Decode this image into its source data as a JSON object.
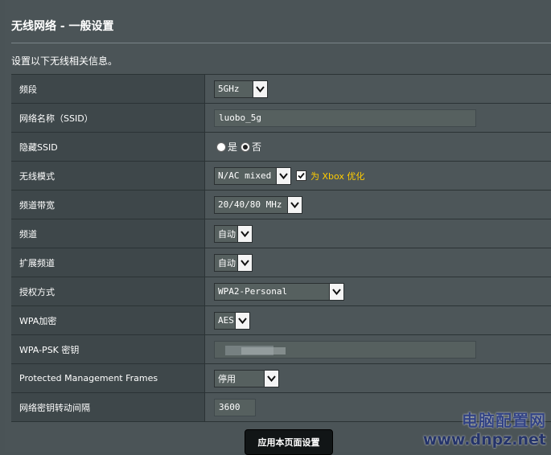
{
  "page": {
    "title": "无线网络 - 一般设置",
    "description": "设置以下无线相关信息。"
  },
  "rows": {
    "band": {
      "label": "频段",
      "value": "5GHz"
    },
    "ssid": {
      "label": "网络名称（SSID）",
      "value": "luobo_5g"
    },
    "hide_ssid": {
      "label": "隐藏SSID",
      "opt_yes": "是",
      "opt_no": "否",
      "selected": "否"
    },
    "wireless_mode": {
      "label": "无线模式",
      "value": "N/AC mixed",
      "xbox_label": "为 Xbox 优化",
      "xbox_checked": true
    },
    "bandwidth": {
      "label": "频道带宽",
      "value": "20/40/80 MHz"
    },
    "channel": {
      "label": "频道",
      "value": "自动"
    },
    "ext_channel": {
      "label": "扩展频道",
      "value": "自动"
    },
    "auth": {
      "label": "授权方式",
      "value": "WPA2-Personal"
    },
    "wpa_enc": {
      "label": "WPA加密",
      "value": "AES"
    },
    "psk": {
      "label": "WPA-PSK 密钥",
      "value": ""
    },
    "pmf": {
      "label": "Protected Management Frames",
      "value": "停用"
    },
    "key_interval": {
      "label": "网络密钥转动间隔",
      "value": "3600"
    }
  },
  "apply_button": "应用本页面设置",
  "watermark": {
    "line1": "电脑配置网",
    "line2": "www.dnpz.net"
  }
}
